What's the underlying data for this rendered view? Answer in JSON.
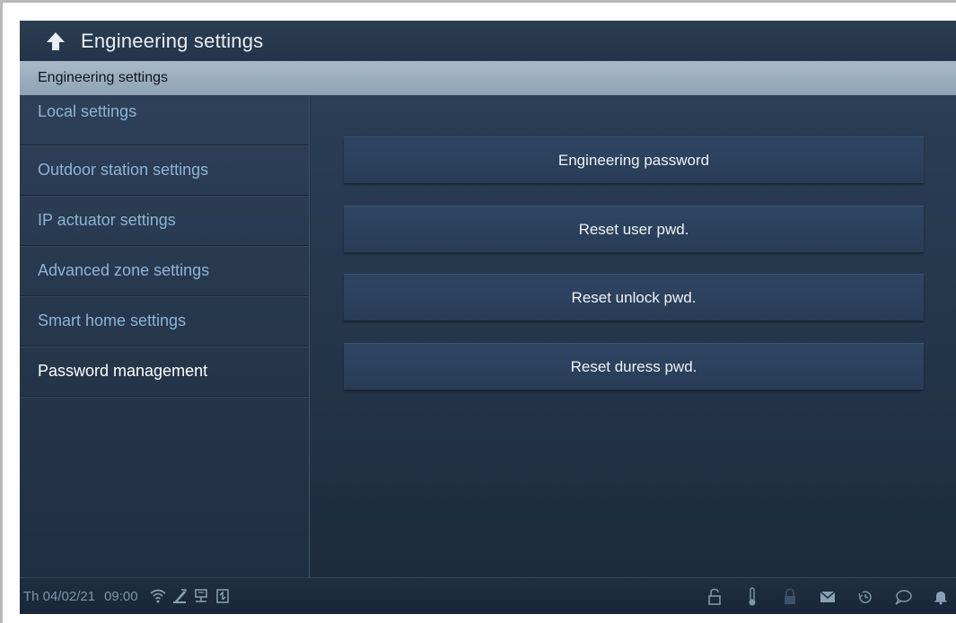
{
  "header": {
    "title": "Engineering settings",
    "back_icon": "back-arrow-icon"
  },
  "section": {
    "title": "Engineering settings"
  },
  "sidebar": {
    "items": [
      {
        "label": "Local settings"
      },
      {
        "label": "Outdoor station settings"
      },
      {
        "label": "IP actuator settings"
      },
      {
        "label": "Advanced zone settings"
      },
      {
        "label": "Smart home settings"
      },
      {
        "label": "Password management",
        "active": true
      }
    ]
  },
  "main": {
    "buttons": [
      {
        "label": "Engineering password"
      },
      {
        "label": "Reset user pwd."
      },
      {
        "label": "Reset unlock pwd."
      },
      {
        "label": "Reset duress pwd."
      }
    ]
  },
  "status": {
    "date": "Th 04/02/21",
    "time": "09:00",
    "left_icons": [
      "wifi-icon",
      "tool-icon",
      "network-icon",
      "sd-card-icon"
    ],
    "right_icons": [
      "unlock-icon",
      "thermometer-icon",
      "lock-icon",
      "mail-icon",
      "history-icon",
      "message-icon",
      "bell-icon"
    ]
  },
  "colors": {
    "background": "#24364a",
    "section_bar": "#9cafc1",
    "inactive_text": "#8eb3d4",
    "active_text": "#ffffff"
  }
}
